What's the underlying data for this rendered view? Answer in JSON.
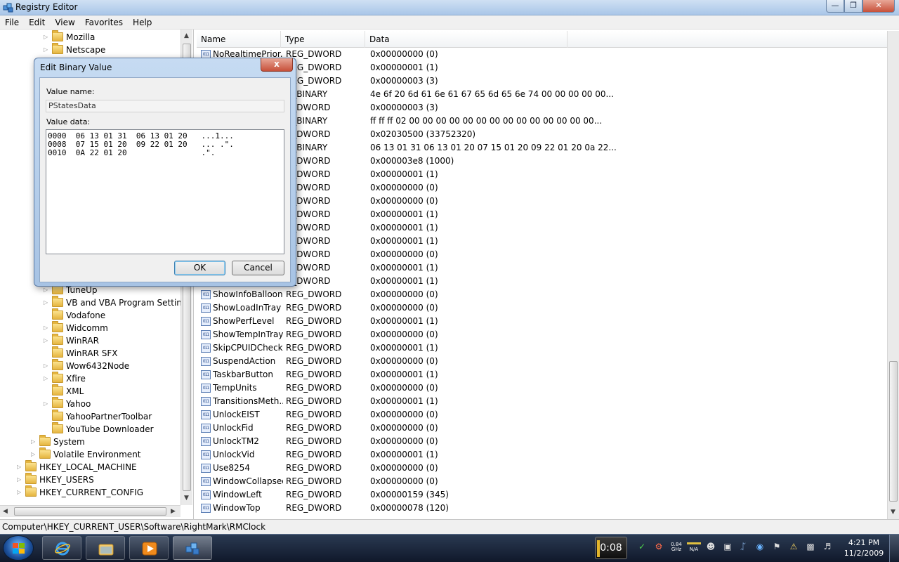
{
  "window": {
    "title": "Registry Editor"
  },
  "menu": [
    "File",
    "Edit",
    "View",
    "Favorites",
    "Help"
  ],
  "tree": [
    {
      "label": "Mozilla",
      "level": 3,
      "expandable": true
    },
    {
      "label": "Netscape",
      "level": 3,
      "expandable": true
    },
    {
      "label": "TuneUp",
      "level": 3,
      "expandable": true
    },
    {
      "label": "VB and VBA Program Settings",
      "level": 3,
      "expandable": true
    },
    {
      "label": "Vodafone",
      "level": 3,
      "expandable": false
    },
    {
      "label": "Widcomm",
      "level": 3,
      "expandable": true
    },
    {
      "label": "WinRAR",
      "level": 3,
      "expandable": true
    },
    {
      "label": "WinRAR SFX",
      "level": 3,
      "expandable": false
    },
    {
      "label": "Wow6432Node",
      "level": 3,
      "expandable": true
    },
    {
      "label": "Xfire",
      "level": 3,
      "expandable": true
    },
    {
      "label": "XML",
      "level": 3,
      "expandable": false
    },
    {
      "label": "Yahoo",
      "level": 3,
      "expandable": true
    },
    {
      "label": "YahooPartnerToolbar",
      "level": 3,
      "expandable": false
    },
    {
      "label": "YouTube Downloader",
      "level": 3,
      "expandable": false
    },
    {
      "label": "System",
      "level": 2,
      "expandable": true
    },
    {
      "label": "Volatile Environment",
      "level": 2,
      "expandable": true
    },
    {
      "label": "HKEY_LOCAL_MACHINE",
      "level": 1,
      "expandable": true
    },
    {
      "label": "HKEY_USERS",
      "level": 1,
      "expandable": true
    },
    {
      "label": "HKEY_CURRENT_CONFIG",
      "level": 1,
      "expandable": true
    }
  ],
  "columns": {
    "name": "Name",
    "type": "Type",
    "data": "Data"
  },
  "rows": [
    {
      "name": "NoRealtimePrior...",
      "type": "REG_DWORD",
      "data": "0x00000000 (0)"
    },
    {
      "name": "",
      "type": "REG_DWORD",
      "data": "0x00000001 (1)"
    },
    {
      "name": "",
      "type": "REG_DWORD",
      "data": "0x00000003 (3)"
    },
    {
      "name": "",
      "type": "G_BINARY",
      "data": "4e 6f 20 6d 61 6e 61 67 65 6d 65 6e 74 00 00 00 00 00..."
    },
    {
      "name": "",
      "type": "G_DWORD",
      "data": "0x00000003 (3)"
    },
    {
      "name": "",
      "type": "G_BINARY",
      "data": "ff ff ff 02 00 00 00 00 00 00 00 00 00 00 00 00 00 00..."
    },
    {
      "name": "",
      "type": "G_DWORD",
      "data": "0x02030500 (33752320)"
    },
    {
      "name": "",
      "type": "G_BINARY",
      "data": "06 13 01 31 06 13 01 20 07 15 01 20 09 22 01 20 0a 22..."
    },
    {
      "name": "",
      "type": "G_DWORD",
      "data": "0x000003e8 (1000)"
    },
    {
      "name": "",
      "type": "G_DWORD",
      "data": "0x00000001 (1)"
    },
    {
      "name": "",
      "type": "G_DWORD",
      "data": "0x00000000 (0)"
    },
    {
      "name": "",
      "type": "G_DWORD",
      "data": "0x00000000 (0)"
    },
    {
      "name": "",
      "type": "G_DWORD",
      "data": "0x00000001 (1)"
    },
    {
      "name": "",
      "type": "G_DWORD",
      "data": "0x00000001 (1)"
    },
    {
      "name": "",
      "type": "G_DWORD",
      "data": "0x00000001 (1)"
    },
    {
      "name": "",
      "type": "G_DWORD",
      "data": "0x00000000 (0)"
    },
    {
      "name": "",
      "type": "G_DWORD",
      "data": "0x00000001 (1)"
    },
    {
      "name": "",
      "type": "G_DWORD",
      "data": "0x00000001 (1)"
    },
    {
      "name": "ShowInfoBalloons",
      "type": "REG_DWORD",
      "data": "0x00000000 (0)"
    },
    {
      "name": "ShowLoadInTray",
      "type": "REG_DWORD",
      "data": "0x00000000 (0)"
    },
    {
      "name": "ShowPerfLevel",
      "type": "REG_DWORD",
      "data": "0x00000001 (1)"
    },
    {
      "name": "ShowTempInTray",
      "type": "REG_DWORD",
      "data": "0x00000000 (0)"
    },
    {
      "name": "SkipCPUIDCheck",
      "type": "REG_DWORD",
      "data": "0x00000001 (1)"
    },
    {
      "name": "SuspendAction",
      "type": "REG_DWORD",
      "data": "0x00000000 (0)"
    },
    {
      "name": "TaskbarButton",
      "type": "REG_DWORD",
      "data": "0x00000001 (1)"
    },
    {
      "name": "TempUnits",
      "type": "REG_DWORD",
      "data": "0x00000000 (0)"
    },
    {
      "name": "TransitionsMeth...",
      "type": "REG_DWORD",
      "data": "0x00000001 (1)"
    },
    {
      "name": "UnlockEIST",
      "type": "REG_DWORD",
      "data": "0x00000000 (0)"
    },
    {
      "name": "UnlockFid",
      "type": "REG_DWORD",
      "data": "0x00000000 (0)"
    },
    {
      "name": "UnlockTM2",
      "type": "REG_DWORD",
      "data": "0x00000000 (0)"
    },
    {
      "name": "UnlockVid",
      "type": "REG_DWORD",
      "data": "0x00000001 (1)"
    },
    {
      "name": "Use8254",
      "type": "REG_DWORD",
      "data": "0x00000000 (0)"
    },
    {
      "name": "WindowCollapsed",
      "type": "REG_DWORD",
      "data": "0x00000000 (0)"
    },
    {
      "name": "WindowLeft",
      "type": "REG_DWORD",
      "data": "0x00000159 (345)"
    },
    {
      "name": "WindowTop",
      "type": "REG_DWORD",
      "data": "0x00000078 (120)"
    }
  ],
  "status": "Computer\\HKEY_CURRENT_USER\\Software\\RightMark\\RMClock",
  "dialog": {
    "title": "Edit Binary Value",
    "close": "x",
    "value_name_label": "Value name:",
    "value_name": "PStatesData",
    "value_data_label": "Value data:",
    "hex_lines": [
      "0000  06 13 01 31  06 13 01 20   ...1...",
      "0008  07 15 01 20  09 22 01 20   ... .\".",
      "0010  0A 22 01 20                .\"."
    ],
    "ok": "OK",
    "cancel": "Cancel"
  },
  "taskbar": {
    "gadget_time": "0:08",
    "cpu_freq": "0.84 GHz",
    "na": "N/A",
    "clock_time": "4:21 PM",
    "clock_date": "11/2/2009"
  }
}
